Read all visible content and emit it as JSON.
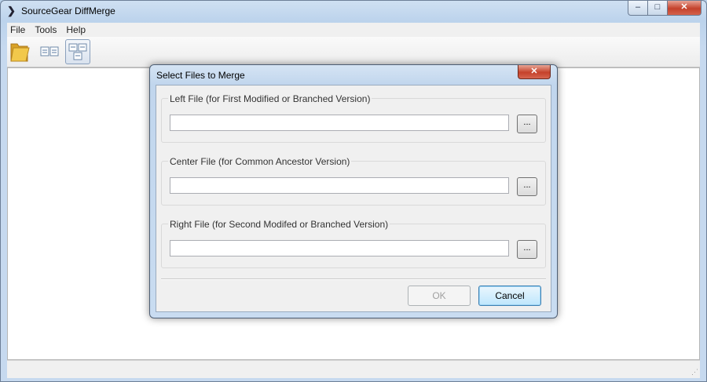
{
  "window": {
    "title": "SourceGear DiffMerge",
    "controls": {
      "minimize": "‒",
      "maximize": "□",
      "close": "✕"
    }
  },
  "menu": [
    "File",
    "Tools",
    "Help"
  ],
  "toolbar": {
    "buttons": [
      {
        "name": "open-folder",
        "icon": "folder-icon"
      },
      {
        "name": "diff-two-files",
        "icon": "two-panes-icon"
      },
      {
        "name": "merge-three-files",
        "icon": "three-panes-icon",
        "active": true
      }
    ]
  },
  "dialog": {
    "title": "Select Files to Merge",
    "close_label": "✕",
    "left_file": {
      "label": "Left File (for First Modified or Branched Version)",
      "value": "",
      "browse": "..."
    },
    "center_file": {
      "label": "Center File (for Common Ancestor Version)",
      "value": "",
      "browse": "..."
    },
    "right_file": {
      "label": "Right File (for Second Modifed or Branched Version)",
      "value": "",
      "browse": "..."
    },
    "ok_label": "OK",
    "ok_enabled": false,
    "cancel_label": "Cancel"
  },
  "colors": {
    "accent": "#3c7fb1",
    "frame": "#c1d6ed",
    "close": "#c5412a"
  }
}
